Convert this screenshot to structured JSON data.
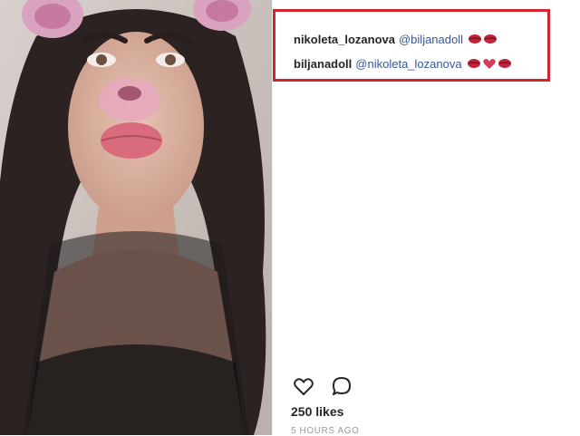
{
  "post": {
    "photo": {
      "description_icon": "selfie-photo-with-bear-ears-filter"
    },
    "comments": [
      {
        "username": "nikoleta_lozanova",
        "mention": "@biljanadoll",
        "emojis": [
          "lips-icon",
          "lips-icon"
        ]
      },
      {
        "username": "biljanadoll",
        "mention": "@nikoleta_lozanova",
        "emojis": [
          "lips-icon",
          "heart-icon",
          "lips-icon"
        ]
      }
    ],
    "actions": {
      "like_icon": "heart-outline-icon",
      "comment_icon": "speech-bubble-icon"
    },
    "likes": "250 likes",
    "timestamp": "5 HOURS AGO"
  },
  "colors": {
    "highlight_border": "#d3252f",
    "mention_link": "#365899",
    "text": "#262626",
    "muted": "#999999"
  }
}
